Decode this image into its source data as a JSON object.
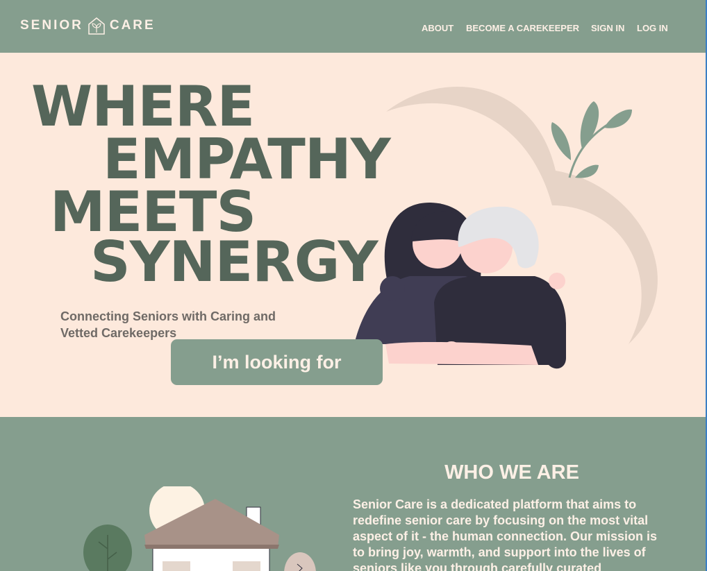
{
  "header": {
    "logo_left": "SENIOR",
    "logo_right": "CARE",
    "nav": {
      "about": "ABOUT",
      "become": "BECOME A CAREKEEPER",
      "signin": "SIGN IN",
      "login": "LOG IN"
    }
  },
  "hero": {
    "headline": [
      "WHERE",
      "EMPATHY",
      "MEETS",
      "SYNERGY"
    ],
    "subtitle": "Connecting Seniors with Caring and Vetted Carekeepers",
    "cta_label": "I’m looking for"
  },
  "about": {
    "title": "WHO WE ARE",
    "body": "Senior Care is a dedicated platform that aims to redefine senior care by focusing on the most vital aspect of it - the human connection. Our mission is to bring joy, warmth, and support into the lives of seniors like you through carefully curated"
  },
  "colors": {
    "sage": "#859e8e",
    "cream": "#fde9dc",
    "headline": "#55665a"
  }
}
